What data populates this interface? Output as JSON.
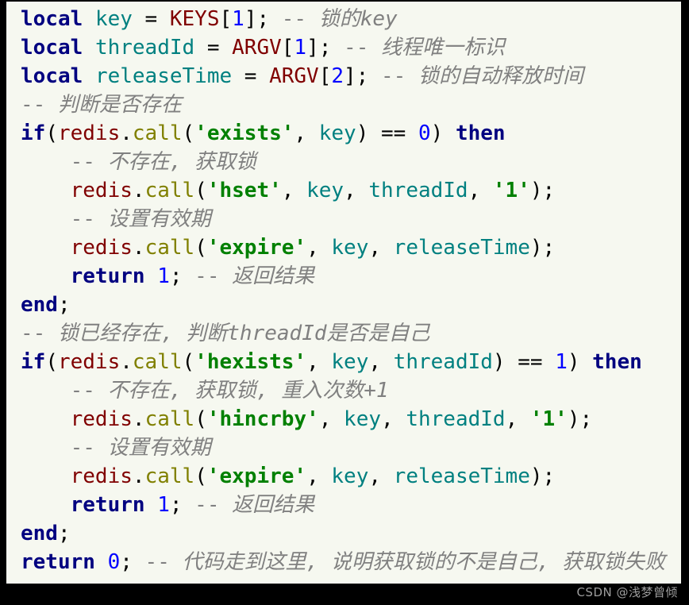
{
  "window": {
    "kind": "code-screenshot",
    "language": "lua",
    "background_color": "#000000",
    "code_background_color": "#f6f8f0"
  },
  "theme": {
    "keyword_color": "#000080",
    "variable_color": "#008080",
    "global_color": "#800000",
    "method_color": "#808000",
    "string_color": "#008000",
    "number_color": "#0000ff",
    "comment_color": "#808080",
    "punctuation_color": "#000000"
  },
  "watermark": {
    "text": "CSDN @浅梦曾倾"
  },
  "code": {
    "plain_text": "local key = KEYS[1]; -- 锁的key\nlocal threadId = ARGV[1]; -- 线程唯一标识\nlocal releaseTime = ARGV[2]; -- 锁的自动释放时间\n-- 判断是否存在\nif(redis.call('exists', key) == 0) then\n    -- 不存在, 获取锁\n    redis.call('hset', key, threadId, '1');\n    -- 设置有效期\n    redis.call('expire', key, releaseTime);\n    return 1; -- 返回结果\nend;\n-- 锁已经存在, 判断threadId是否是自己\nif(redis.call('hexists', key, threadId) == 1) then\n    -- 不存在, 获取锁, 重入次数+1\n    redis.call('hincrby', key, threadId, '1');\n    -- 设置有效期\n    redis.call('expire', key, releaseTime);\n    return 1; -- 返回结果\nend;\nreturn 0; -- 代码走到这里, 说明获取锁的不是自己, 获取锁失败",
    "lines": [
      {
        "index": 1,
        "text": "local key = KEYS[1]; -- 锁的key",
        "tokens": [
          {
            "t": "local",
            "c": "kw"
          },
          {
            "t": " ",
            "c": "punc"
          },
          {
            "t": "key",
            "c": "var"
          },
          {
            "t": " = ",
            "c": "op"
          },
          {
            "t": "KEYS",
            "c": "global"
          },
          {
            "t": "[",
            "c": "punc"
          },
          {
            "t": "1",
            "c": "num"
          },
          {
            "t": "]; ",
            "c": "punc"
          },
          {
            "t": "-- ",
            "c": "comment-dash"
          },
          {
            "t": "锁的key",
            "c": "comment"
          }
        ]
      },
      {
        "index": 2,
        "text": "local threadId = ARGV[1]; -- 线程唯一标识",
        "tokens": [
          {
            "t": "local",
            "c": "kw"
          },
          {
            "t": " ",
            "c": "punc"
          },
          {
            "t": "threadId",
            "c": "var"
          },
          {
            "t": " = ",
            "c": "op"
          },
          {
            "t": "ARGV",
            "c": "global"
          },
          {
            "t": "[",
            "c": "punc"
          },
          {
            "t": "1",
            "c": "num"
          },
          {
            "t": "]; ",
            "c": "punc"
          },
          {
            "t": "-- ",
            "c": "comment-dash"
          },
          {
            "t": "线程唯一标识",
            "c": "comment"
          }
        ]
      },
      {
        "index": 3,
        "text": "local releaseTime = ARGV[2]; -- 锁的自动释放时间",
        "tokens": [
          {
            "t": "local",
            "c": "kw"
          },
          {
            "t": " ",
            "c": "punc"
          },
          {
            "t": "releaseTime",
            "c": "var"
          },
          {
            "t": " = ",
            "c": "op"
          },
          {
            "t": "ARGV",
            "c": "global"
          },
          {
            "t": "[",
            "c": "punc"
          },
          {
            "t": "2",
            "c": "num"
          },
          {
            "t": "]; ",
            "c": "punc"
          },
          {
            "t": "-- ",
            "c": "comment-dash"
          },
          {
            "t": "锁的自动释放时间",
            "c": "comment"
          }
        ]
      },
      {
        "index": 4,
        "text": "-- 判断是否存在",
        "tokens": [
          {
            "t": "-- ",
            "c": "comment-dash"
          },
          {
            "t": "判断是否存在",
            "c": "comment"
          }
        ]
      },
      {
        "index": 5,
        "text": "if(redis.call('exists', key) == 0) then",
        "tokens": [
          {
            "t": "if",
            "c": "kw"
          },
          {
            "t": "(",
            "c": "punc"
          },
          {
            "t": "redis",
            "c": "obj"
          },
          {
            "t": ".",
            "c": "punc"
          },
          {
            "t": "call",
            "c": "method"
          },
          {
            "t": "(",
            "c": "punc"
          },
          {
            "t": "'exists'",
            "c": "str"
          },
          {
            "t": ", ",
            "c": "punc"
          },
          {
            "t": "key",
            "c": "var"
          },
          {
            "t": ")",
            "c": "punc"
          },
          {
            "t": " == ",
            "c": "op"
          },
          {
            "t": "0",
            "c": "num"
          },
          {
            "t": ") ",
            "c": "punc"
          },
          {
            "t": "then",
            "c": "kw"
          }
        ]
      },
      {
        "index": 6,
        "text": "    -- 不存在, 获取锁",
        "tokens": [
          {
            "t": "    ",
            "c": "punc"
          },
          {
            "t": "-- ",
            "c": "comment-dash"
          },
          {
            "t": "不存在, 获取锁",
            "c": "comment"
          }
        ]
      },
      {
        "index": 7,
        "text": "    redis.call('hset', key, threadId, '1');",
        "tokens": [
          {
            "t": "    ",
            "c": "punc"
          },
          {
            "t": "redis",
            "c": "obj"
          },
          {
            "t": ".",
            "c": "punc"
          },
          {
            "t": "call",
            "c": "method"
          },
          {
            "t": "(",
            "c": "punc"
          },
          {
            "t": "'hset'",
            "c": "str"
          },
          {
            "t": ", ",
            "c": "punc"
          },
          {
            "t": "key",
            "c": "var"
          },
          {
            "t": ", ",
            "c": "punc"
          },
          {
            "t": "threadId",
            "c": "var"
          },
          {
            "t": ", ",
            "c": "punc"
          },
          {
            "t": "'1'",
            "c": "str"
          },
          {
            "t": ");",
            "c": "punc"
          }
        ]
      },
      {
        "index": 8,
        "text": "    -- 设置有效期",
        "tokens": [
          {
            "t": "    ",
            "c": "punc"
          },
          {
            "t": "-- ",
            "c": "comment-dash"
          },
          {
            "t": "设置有效期",
            "c": "comment"
          }
        ]
      },
      {
        "index": 9,
        "text": "    redis.call('expire', key, releaseTime);",
        "tokens": [
          {
            "t": "    ",
            "c": "punc"
          },
          {
            "t": "redis",
            "c": "obj"
          },
          {
            "t": ".",
            "c": "punc"
          },
          {
            "t": "call",
            "c": "method"
          },
          {
            "t": "(",
            "c": "punc"
          },
          {
            "t": "'expire'",
            "c": "str"
          },
          {
            "t": ", ",
            "c": "punc"
          },
          {
            "t": "key",
            "c": "var"
          },
          {
            "t": ", ",
            "c": "punc"
          },
          {
            "t": "releaseTime",
            "c": "var"
          },
          {
            "t": ");",
            "c": "punc"
          }
        ]
      },
      {
        "index": 10,
        "text": "    return 1; -- 返回结果",
        "tokens": [
          {
            "t": "    ",
            "c": "punc"
          },
          {
            "t": "return",
            "c": "kw"
          },
          {
            "t": " ",
            "c": "punc"
          },
          {
            "t": "1",
            "c": "num"
          },
          {
            "t": "; ",
            "c": "punc"
          },
          {
            "t": "-- ",
            "c": "comment-dash"
          },
          {
            "t": "返回结果",
            "c": "comment"
          }
        ]
      },
      {
        "index": 11,
        "text": "end;",
        "tokens": [
          {
            "t": "end",
            "c": "kw"
          },
          {
            "t": ";",
            "c": "punc"
          }
        ]
      },
      {
        "index": 12,
        "text": "-- 锁已经存在, 判断threadId是否是自己",
        "tokens": [
          {
            "t": "-- ",
            "c": "comment-dash"
          },
          {
            "t": "锁已经存在, 判断threadId是否是自己",
            "c": "comment"
          }
        ]
      },
      {
        "index": 13,
        "text": "if(redis.call('hexists', key, threadId) == 1) then",
        "tokens": [
          {
            "t": "if",
            "c": "kw"
          },
          {
            "t": "(",
            "c": "punc"
          },
          {
            "t": "redis",
            "c": "obj"
          },
          {
            "t": ".",
            "c": "punc"
          },
          {
            "t": "call",
            "c": "method"
          },
          {
            "t": "(",
            "c": "punc"
          },
          {
            "t": "'hexists'",
            "c": "str"
          },
          {
            "t": ", ",
            "c": "punc"
          },
          {
            "t": "key",
            "c": "var"
          },
          {
            "t": ", ",
            "c": "punc"
          },
          {
            "t": "threadId",
            "c": "var"
          },
          {
            "t": ")",
            "c": "punc"
          },
          {
            "t": " == ",
            "c": "op"
          },
          {
            "t": "1",
            "c": "num"
          },
          {
            "t": ") ",
            "c": "punc"
          },
          {
            "t": "then",
            "c": "kw"
          }
        ]
      },
      {
        "index": 14,
        "text": "    -- 不存在, 获取锁, 重入次数+1",
        "tokens": [
          {
            "t": "    ",
            "c": "punc"
          },
          {
            "t": "-- ",
            "c": "comment-dash"
          },
          {
            "t": "不存在, 获取锁, 重入次数+1",
            "c": "comment"
          }
        ]
      },
      {
        "index": 15,
        "text": "    redis.call('hincrby', key, threadId, '1');",
        "tokens": [
          {
            "t": "    ",
            "c": "punc"
          },
          {
            "t": "redis",
            "c": "obj"
          },
          {
            "t": ".",
            "c": "punc"
          },
          {
            "t": "call",
            "c": "method"
          },
          {
            "t": "(",
            "c": "punc"
          },
          {
            "t": "'hincrby'",
            "c": "str"
          },
          {
            "t": ", ",
            "c": "punc"
          },
          {
            "t": "key",
            "c": "var"
          },
          {
            "t": ", ",
            "c": "punc"
          },
          {
            "t": "threadId",
            "c": "var"
          },
          {
            "t": ", ",
            "c": "punc"
          },
          {
            "t": "'1'",
            "c": "str"
          },
          {
            "t": ");",
            "c": "punc"
          }
        ]
      },
      {
        "index": 16,
        "text": "    -- 设置有效期",
        "tokens": [
          {
            "t": "    ",
            "c": "punc"
          },
          {
            "t": "-- ",
            "c": "comment-dash"
          },
          {
            "t": "设置有效期",
            "c": "comment"
          }
        ]
      },
      {
        "index": 17,
        "text": "    redis.call('expire', key, releaseTime);",
        "tokens": [
          {
            "t": "    ",
            "c": "punc"
          },
          {
            "t": "redis",
            "c": "obj"
          },
          {
            "t": ".",
            "c": "punc"
          },
          {
            "t": "call",
            "c": "method"
          },
          {
            "t": "(",
            "c": "punc"
          },
          {
            "t": "'expire'",
            "c": "str"
          },
          {
            "t": ", ",
            "c": "punc"
          },
          {
            "t": "key",
            "c": "var"
          },
          {
            "t": ", ",
            "c": "punc"
          },
          {
            "t": "releaseTime",
            "c": "var"
          },
          {
            "t": ");",
            "c": "punc"
          }
        ]
      },
      {
        "index": 18,
        "text": "    return 1; -- 返回结果",
        "tokens": [
          {
            "t": "    ",
            "c": "punc"
          },
          {
            "t": "return",
            "c": "kw"
          },
          {
            "t": " ",
            "c": "punc"
          },
          {
            "t": "1",
            "c": "num"
          },
          {
            "t": "; ",
            "c": "punc"
          },
          {
            "t": "-- ",
            "c": "comment-dash"
          },
          {
            "t": "返回结果",
            "c": "comment"
          }
        ]
      },
      {
        "index": 19,
        "text": "end;",
        "tokens": [
          {
            "t": "end",
            "c": "kw"
          },
          {
            "t": ";",
            "c": "punc"
          }
        ]
      },
      {
        "index": 20,
        "text": "return 0; -- 代码走到这里, 说明获取锁的不是自己, 获取锁失败",
        "tokens": [
          {
            "t": "return",
            "c": "kw"
          },
          {
            "t": " ",
            "c": "punc"
          },
          {
            "t": "0",
            "c": "num"
          },
          {
            "t": "; ",
            "c": "punc"
          },
          {
            "t": "-- ",
            "c": "comment-dash"
          },
          {
            "t": "代码走到这里, 说明获取锁的不是自己, 获取锁失败",
            "c": "comment"
          }
        ]
      }
    ]
  }
}
